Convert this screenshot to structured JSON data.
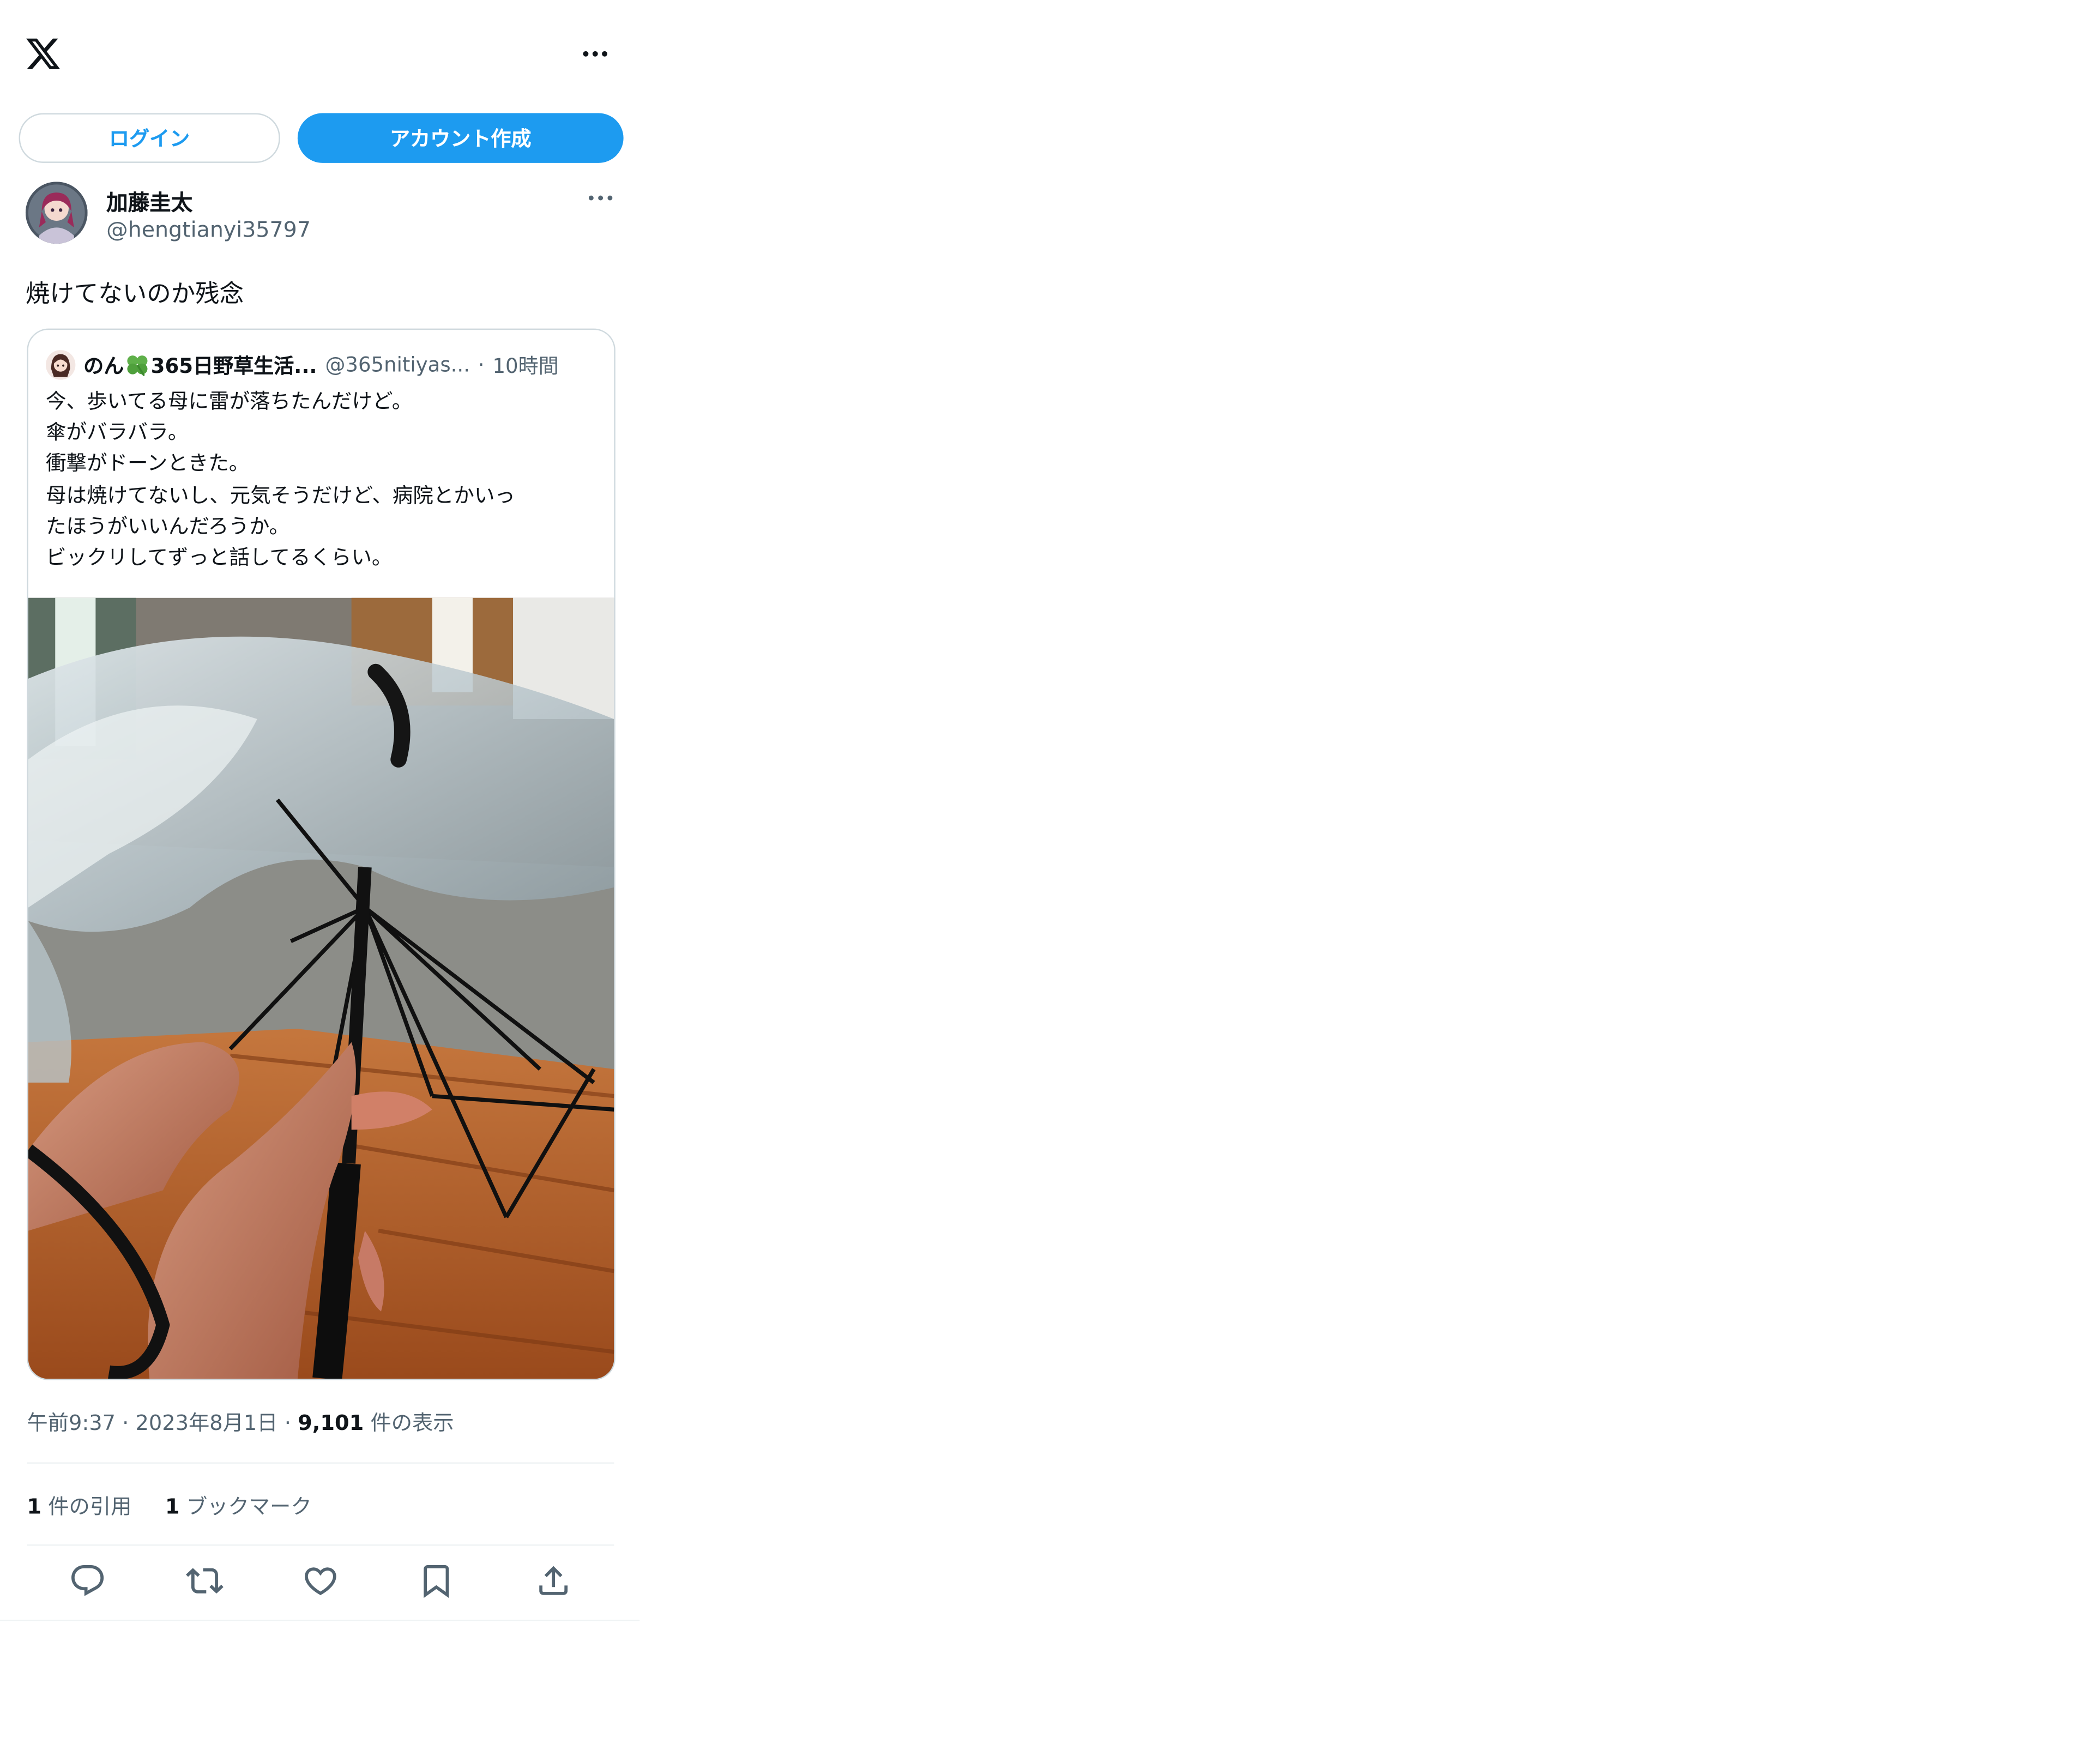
{
  "header": {
    "logo_icon": "x-logo-icon",
    "more_icon": "more-horizontal-icon"
  },
  "auth": {
    "login_label": "ログイン",
    "signup_label": "アカウント作成"
  },
  "colors": {
    "accent": "#1d9bf0",
    "text_primary": "#0f1419",
    "text_secondary": "#536471",
    "border": "#cfd9de"
  },
  "tweet": {
    "author_name": "加藤圭太",
    "author_handle": "@hengtianyi35797",
    "text": "焼けてないのか残念",
    "time": "午前9:37",
    "date": "2023年8月1日",
    "views_count": "9,101",
    "views_label": "件の表示",
    "quotes_count": "1",
    "quotes_label": "件の引用",
    "bookmarks_count": "1",
    "bookmarks_label": "ブックマーク",
    "meta_sep": "·"
  },
  "quoted": {
    "name_prefix": "のん",
    "name_suffix": "365日野草生活...",
    "handle": "@365nitiyas...",
    "dot": "·",
    "time": "10時間",
    "lines": [
      "今、歩いてる母に雷が落ちたんだけど。",
      "傘がバラバラ。",
      "衝撃がドーンときた。",
      "母は焼けてないし、元気そうだけど、病院とかいっ",
      "たほうがいいんだろうか。",
      "ビックリしてずっと話してるくらい。"
    ]
  },
  "actions": [
    {
      "icon": "reply-icon"
    },
    {
      "icon": "retweet-icon"
    },
    {
      "icon": "like-icon"
    },
    {
      "icon": "bookmark-icon"
    },
    {
      "icon": "share-icon"
    }
  ]
}
